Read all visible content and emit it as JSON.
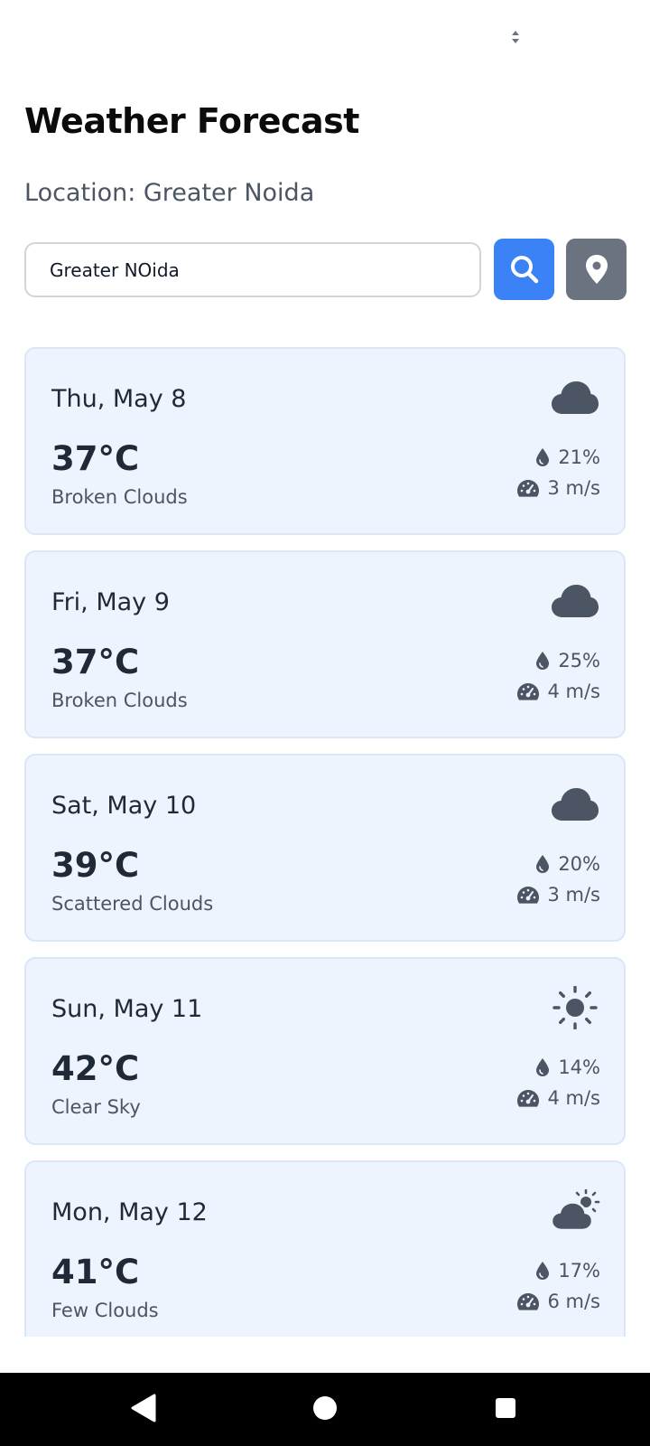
{
  "header": {
    "title": "Weather Forecast",
    "location_line": "Location: Greater Noida"
  },
  "search": {
    "value": "Greater NOida",
    "search_button_icon": "search-icon",
    "location_button_icon": "location-pin-icon"
  },
  "colors": {
    "search_button": "#3b82f6",
    "location_button": "#6b7280",
    "card_background": "#eef4fd",
    "icon_color": "#4b5563"
  },
  "forecast": [
    {
      "date": "Thu, May 8",
      "temp": "37°C",
      "description": "Broken Clouds",
      "humidity": "21%",
      "wind": "3 m/s",
      "icon": "cloud-icon"
    },
    {
      "date": "Fri, May 9",
      "temp": "37°C",
      "description": "Broken Clouds",
      "humidity": "25%",
      "wind": "4 m/s",
      "icon": "cloud-icon"
    },
    {
      "date": "Sat, May 10",
      "temp": "39°C",
      "description": "Scattered Clouds",
      "humidity": "20%",
      "wind": "3 m/s",
      "icon": "cloud-icon"
    },
    {
      "date": "Sun, May 11",
      "temp": "42°C",
      "description": "Clear Sky",
      "humidity": "14%",
      "wind": "4 m/s",
      "icon": "sun-icon"
    },
    {
      "date": "Mon, May 12",
      "temp": "41°C",
      "description": "Few Clouds",
      "humidity": "17%",
      "wind": "6 m/s",
      "icon": "cloud-sun-icon"
    }
  ],
  "nav": {
    "back_icon": "back-triangle-icon",
    "home_icon": "home-circle-icon",
    "recents_icon": "recents-square-icon"
  }
}
